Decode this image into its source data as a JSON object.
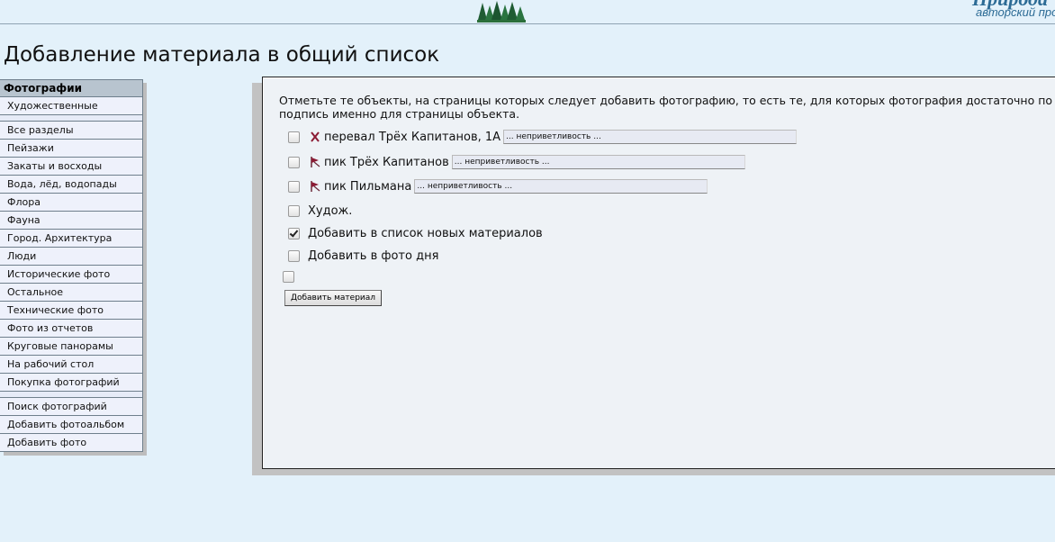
{
  "header": {
    "brand": "Природа",
    "brand_sub": "авторский проект"
  },
  "page": {
    "title": "Добавление материала в общий список"
  },
  "sidebar": {
    "header": "Фотографии",
    "groups": [
      [
        "Художественные"
      ],
      [
        "Все разделы",
        "Пейзажи",
        "Закаты и восходы",
        "Вода, лёд, водопады",
        "Флора",
        "Фауна",
        "Город. Архитектура",
        "Люди",
        "Исторические фото",
        "Остальное",
        "Технические фото",
        "Фото из отчетов",
        "Круговые панорамы",
        "На рабочий стол",
        "Покупка фотографий"
      ],
      [
        "Поиск фотографий",
        "Добавить фотоальбом",
        "Добавить фото"
      ]
    ]
  },
  "form": {
    "intro_line1": "Отметьте те объекты, на страницы которых следует добавить фотографию, то есть те, для которых фотография достаточно по",
    "intro_line2": "подпись именно для страницы объекта.",
    "objects": [
      {
        "icon": "pass-icon",
        "label": "перевал Трёх Капитанов, 1А",
        "note": "... неприветливость ...",
        "checked": false
      },
      {
        "icon": "peak-flag-icon",
        "label": "пик Трёх Капитанов",
        "note": "... неприветливость ...",
        "checked": false
      },
      {
        "icon": "peak-flag-icon",
        "label": "пик Пильмана",
        "note": "... неприветливость ...",
        "checked": false
      }
    ],
    "options": [
      {
        "label": "Худож.",
        "checked": false
      },
      {
        "label": "Добавить в список новых материалов",
        "checked": true
      },
      {
        "label": "Добавить в фото дня",
        "checked": false
      }
    ],
    "submit_label": "Добавить материал"
  }
}
